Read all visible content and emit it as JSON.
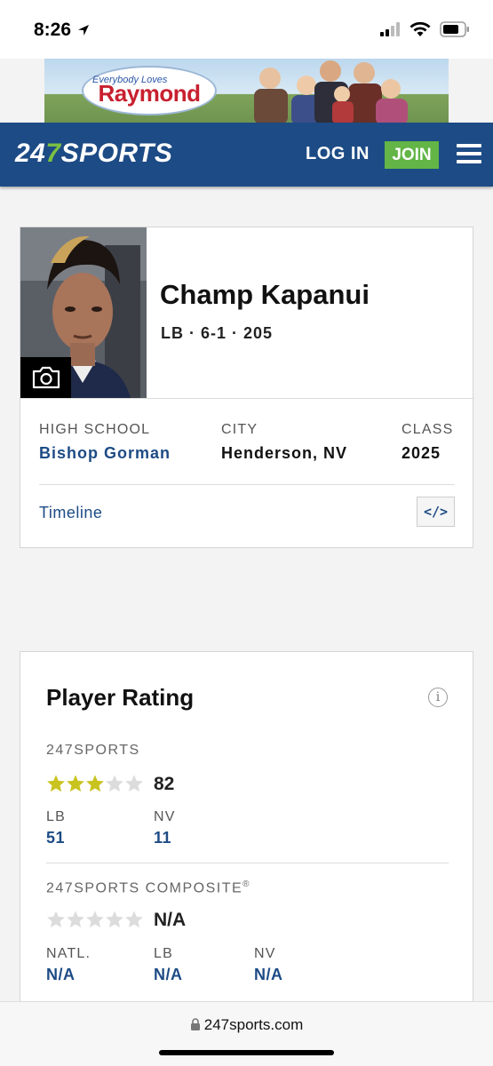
{
  "status_bar": {
    "time": "8:26"
  },
  "ad": {
    "logo_small": "Everybody Loves",
    "logo_big": "Raymond"
  },
  "nav": {
    "logo_prefix": "24",
    "logo_seven": "7",
    "logo_suffix": "SPORTS",
    "login_label": "LOG IN",
    "join_label": "JOIN"
  },
  "profile": {
    "name": "Champ Kapanui",
    "meta": "LB · 6-1 · 205",
    "high_school_label": "HIGH SCHOOL",
    "high_school": "Bishop Gorman",
    "city_label": "CITY",
    "city": "Henderson, NV",
    "class_label": "CLASS",
    "class_year": "2025",
    "timeline_label": "Timeline",
    "embed_label": "</>"
  },
  "rating": {
    "title": "Player Rating",
    "info_label": "i",
    "sports247": {
      "label": "247SPORTS",
      "stars": 3,
      "score": "82",
      "ranks": [
        {
          "label": "LB",
          "value": "51"
        },
        {
          "label": "NV",
          "value": "11"
        }
      ]
    },
    "composite": {
      "label": "247SPORTS COMPOSITE",
      "trademark": "®",
      "stars": 0,
      "score": "N/A",
      "ranks": [
        {
          "label": "NATL.",
          "value": "N/A"
        },
        {
          "label": "LB",
          "value": "N/A"
        },
        {
          "label": "NV",
          "value": "N/A"
        }
      ]
    }
  },
  "browser": {
    "url": "247sports.com"
  },
  "colors": {
    "brand_blue": "#1d4b85",
    "join_green": "#62b546",
    "star_gold": "#c9c31f",
    "star_empty": "#dcdcdc"
  }
}
